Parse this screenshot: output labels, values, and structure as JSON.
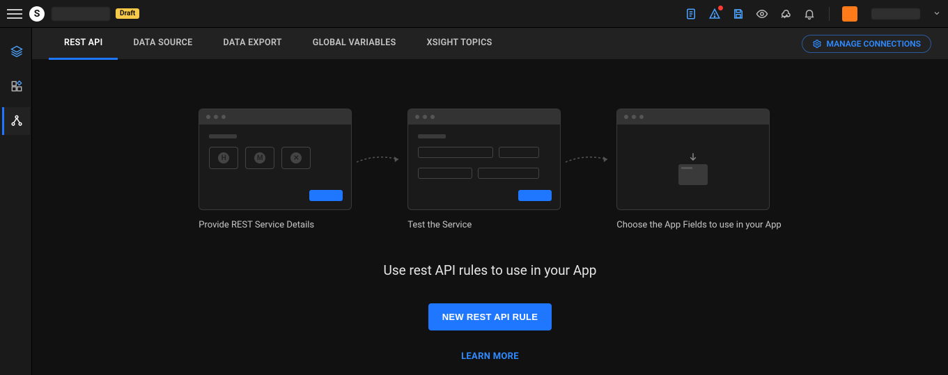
{
  "header": {
    "draft_badge": "Draft"
  },
  "leftnav": {
    "items": [
      {
        "name": "layers-icon"
      },
      {
        "name": "apps-icon"
      },
      {
        "name": "connections-icon"
      }
    ],
    "active_index": 2
  },
  "tabs": {
    "items": [
      "REST API",
      "DATA SOURCE",
      "DATA EXPORT",
      "GLOBAL VARIABLES",
      "XSIGHT TOPICS"
    ],
    "active_index": 0,
    "manage_connections": "MANAGE CONNECTIONS"
  },
  "steps": {
    "cards": [
      {
        "caption": "Provide REST Service Details"
      },
      {
        "caption": "Test the Service"
      },
      {
        "caption": "Choose the App Fields to use in your App"
      }
    ]
  },
  "hero": {
    "subtitle": "Use rest API rules to use in your App",
    "new_button": "NEW REST API RULE",
    "learn_more": "LEARN MORE"
  }
}
